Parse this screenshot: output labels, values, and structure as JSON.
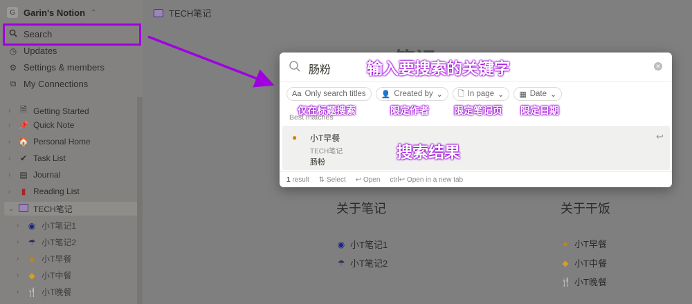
{
  "sidebar": {
    "workspace_initial": "G",
    "workspace_name": "Garin's Notion",
    "nav": [
      {
        "icon": "search-icon",
        "label": "Search"
      },
      {
        "icon": "clock-icon",
        "label": "Updates"
      },
      {
        "icon": "gear-icon",
        "label": "Settings & members"
      },
      {
        "icon": "connections-icon",
        "label": "My Connections"
      }
    ],
    "pages": [
      {
        "icon": "document-icon",
        "label": "Getting Started"
      },
      {
        "icon": "pin-icon",
        "label": "Quick Note"
      },
      {
        "icon": "home-icon",
        "label": "Personal Home"
      },
      {
        "icon": "check-icon",
        "label": "Task List"
      },
      {
        "icon": "notebook-icon",
        "label": "Journal"
      },
      {
        "icon": "book-icon",
        "label": "Reading List"
      },
      {
        "icon": "database-icon",
        "label": "TECH笔记"
      }
    ],
    "subpages": [
      {
        "icon": "target-icon",
        "label": "小T笔记1"
      },
      {
        "icon": "umbrella-icon",
        "label": "小T笔记2"
      },
      {
        "icon": "pancake-icon",
        "label": "小T早餐"
      },
      {
        "icon": "dumpling-icon",
        "label": "小T中餐"
      },
      {
        "icon": "utensils-icon",
        "label": "小T晚餐"
      }
    ]
  },
  "topbar": {
    "title": "TECH笔记"
  },
  "background": {
    "title": "笔记",
    "col1": {
      "heading": "关于笔记",
      "items": [
        "小T笔记1",
        "小T笔记2"
      ]
    },
    "col2": {
      "heading": "关于干饭",
      "items": [
        "小T早餐",
        "小T中餐",
        "小T晚餐"
      ]
    }
  },
  "search": {
    "query": "肠粉",
    "filters": [
      {
        "icon": "Aa",
        "label": "Only search titles"
      },
      {
        "icon": "person-icon",
        "label": "Created by"
      },
      {
        "icon": "page-icon",
        "label": "In page"
      },
      {
        "icon": "calendar-icon",
        "label": "Date"
      }
    ],
    "section_label": "Best matches",
    "result": {
      "title": "小T早餐",
      "path": "TECH笔记",
      "snippet": "肠粉"
    },
    "footer": {
      "count_num": "1",
      "count_text": "result",
      "select_label": "Select",
      "open_label": "Open",
      "newtab_key": "ctrl",
      "newtab_label": "Open in a new tab"
    }
  },
  "annotations": {
    "keyword": "输入要搜索的关键字",
    "title_only": "仅在标题搜索",
    "author": "限定作者",
    "page": "限定笔记页",
    "date": "限定日期",
    "results": "搜索结果"
  },
  "colors": {
    "annotation": "#a000e0",
    "sidebar_bg": "#838280",
    "main_bg": "#7f7f7f"
  }
}
